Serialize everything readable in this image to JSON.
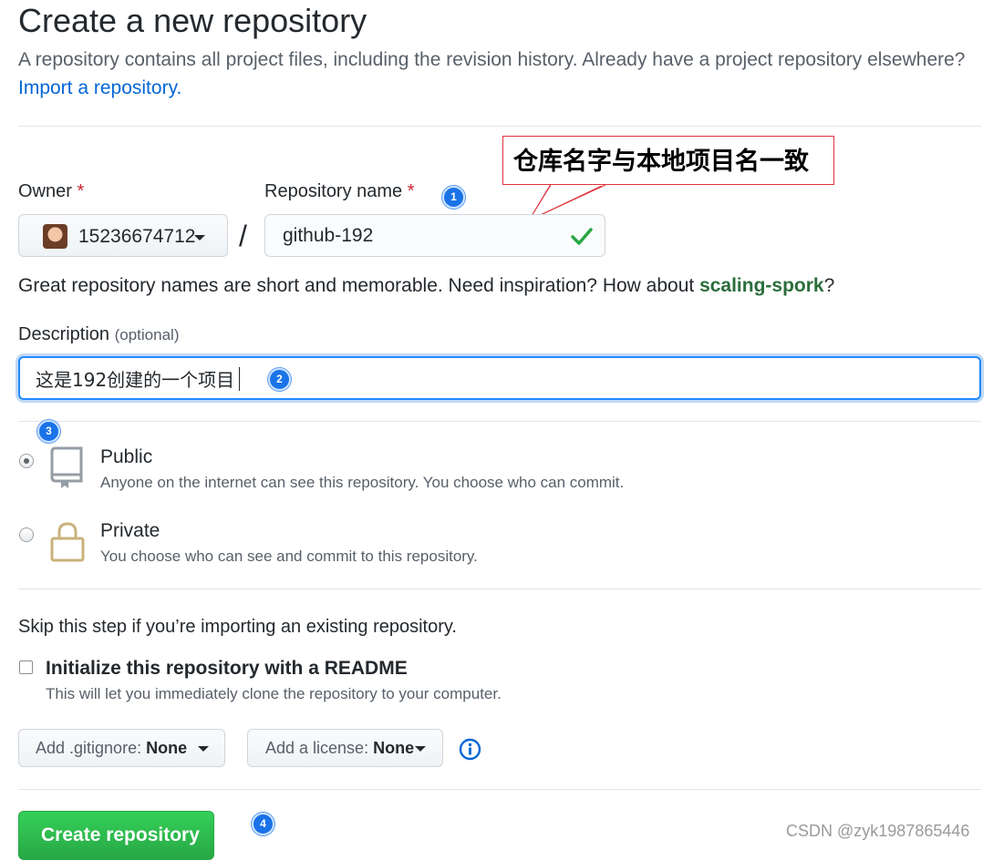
{
  "page": {
    "title": "Create a new repository",
    "subtitle": "A repository contains all project files, including the revision history. Already have a project repository elsewhere?",
    "import_link": "Import a repository."
  },
  "annotation": {
    "callout_text": "仓库名字与本地项目名一致",
    "callout_border_color": "#e0343d",
    "badge_color": "#1a73e8",
    "steps": [
      "1",
      "2",
      "3",
      "4"
    ]
  },
  "owner": {
    "label": "Owner",
    "required_mark": "*",
    "name": "15236674712"
  },
  "separator": "/",
  "repository": {
    "label": "Repository name",
    "required_mark": "*",
    "value": "github-192",
    "valid": true
  },
  "hint": {
    "text": "Great repository names are short and memorable. Need inspiration? How about",
    "suggestion": "scaling-spork",
    "suffix": "?"
  },
  "description": {
    "label": "Description",
    "optional_label": "(optional)",
    "value": "这是192创建的一个项目"
  },
  "visibility": {
    "options": [
      {
        "title": "Public",
        "description": "Anyone on the internet can see this repository. You choose who can commit.",
        "selected": true,
        "icon": "repo-icon"
      },
      {
        "title": "Private",
        "description": "You choose who can see and commit to this repository.",
        "selected": false,
        "icon": "lock-icon"
      }
    ]
  },
  "init": {
    "skip_text": "Skip this step if you’re importing an existing repository.",
    "readme_label": "Initialize this repository with a README",
    "readme_desc": "This will let you immediately clone the repository to your computer.",
    "readme_checked": false
  },
  "gitignore": {
    "label": "Add .gitignore:",
    "value": "None"
  },
  "license": {
    "label": "Add a license:",
    "value": "None"
  },
  "submit": {
    "label": "Create repository",
    "color": "#28a745"
  },
  "watermark": "CSDN @zyk1987865446"
}
